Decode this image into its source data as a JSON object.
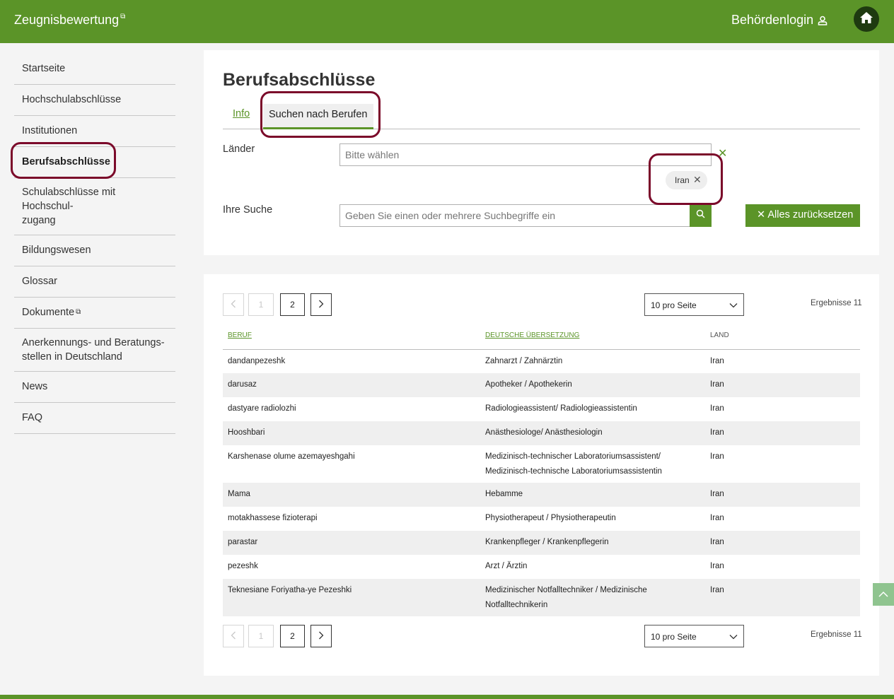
{
  "header": {
    "brand": "Zeugnisbewertung",
    "login": "Behördenlogin"
  },
  "sidebar": {
    "items": [
      {
        "label": "Startseite"
      },
      {
        "label": "Hochschulabschlüsse"
      },
      {
        "label": "Institutionen"
      },
      {
        "label": "Berufsabschlüsse"
      },
      {
        "label": "Schulabschlüsse mit Hochschul-",
        "label2": "zugang"
      },
      {
        "label": "Bildungswesen"
      },
      {
        "label": "Glossar"
      },
      {
        "label": "Dokumente"
      },
      {
        "label": "Anerkennungs- und Beratungs-",
        "label2": "stellen in Deutschland"
      },
      {
        "label": "News"
      },
      {
        "label": "FAQ"
      }
    ]
  },
  "main": {
    "title": "Berufsabschlüsse",
    "tabs": [
      {
        "label": "Info"
      },
      {
        "label": "Suchen nach Berufen"
      }
    ],
    "laender_label": "Länder",
    "laender_placeholder": "Bitte wählen",
    "selected_country": "Iran",
    "suche_label": "Ihre Suche",
    "suche_placeholder": "Geben Sie einen oder mehrere Suchbegriffe ein",
    "reset_label": "Alles zurücksetzen"
  },
  "results": {
    "pages": [
      "1",
      "2"
    ],
    "per_page": "10 pro Seite",
    "count_text": "Ergebnisse 11",
    "columns": [
      "BERUF",
      "DEUTSCHE ÜBERSETZUNG",
      "LAND"
    ],
    "rows": [
      {
        "beruf": "dandanpezeshk",
        "uebersetzung": "Zahnarzt / Zahnärztin",
        "land": "Iran"
      },
      {
        "beruf": "darusaz",
        "uebersetzung": "Apotheker / Apothekerin",
        "land": "Iran"
      },
      {
        "beruf": "dastyare radiolozhi",
        "uebersetzung": "Radiologieassistent/ Radiologieassistentin",
        "land": "Iran"
      },
      {
        "beruf": "Hooshbari",
        "uebersetzung": "Anästhesiologe/ Anästhesiologin",
        "land": "Iran"
      },
      {
        "beruf": "Karshenase olume azemayeshgahi",
        "uebersetzung": "Medizinisch-technischer Laboratoriumsassistent/",
        "uebersetzung2": "Medizinisch-technische Laboratoriumsassistentin",
        "land": "Iran"
      },
      {
        "beruf": "Mama",
        "uebersetzung": "Hebamme",
        "land": "Iran"
      },
      {
        "beruf": "motakhassese fizioterapi",
        "uebersetzung": "Physiotherapeut / Physiotherapeutin",
        "land": "Iran"
      },
      {
        "beruf": "parastar",
        "uebersetzung": "Krankenpfleger / Krankenpflegerin",
        "land": "Iran"
      },
      {
        "beruf": "pezeshk",
        "uebersetzung": "Arzt / Ärztin",
        "land": "Iran"
      },
      {
        "beruf": "Teknesiane Foriyatha-ye Pezeshki",
        "uebersetzung": "Medizinischer Notfalltechniker / Medizinische",
        "uebersetzung2": "Notfalltechnikerin",
        "land": "Iran"
      }
    ]
  },
  "colors": {
    "brand_green": "#5b9428",
    "annotation": "#7b0a2a"
  },
  "icons": {
    "external": "external-link-icon",
    "user": "user-icon",
    "home": "home-icon",
    "search": "search-icon",
    "close": "close-icon",
    "chevron_down": "chevron-down-icon",
    "chevron_left": "chevron-left-icon",
    "chevron_right": "chevron-right-icon",
    "scroll_top": "chevron-up-icon"
  }
}
